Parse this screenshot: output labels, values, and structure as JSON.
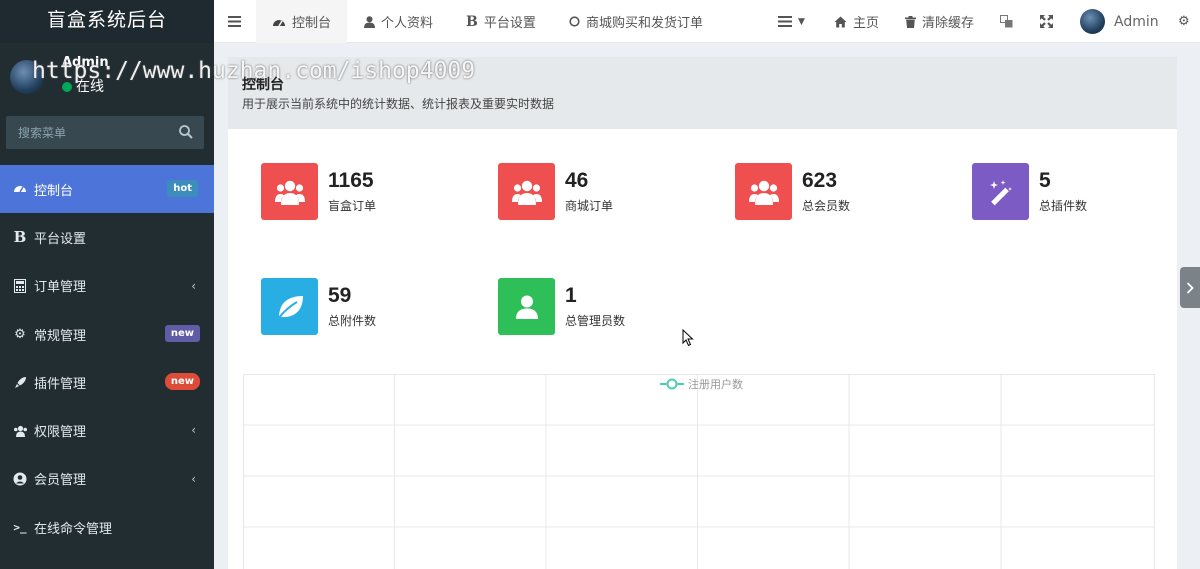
{
  "brand": "盲盒系统后台",
  "user": {
    "name": "Admin",
    "status": "在线"
  },
  "watermark": "https://www.huzhan.com/ishop4009",
  "search": {
    "placeholder": "搜索菜单"
  },
  "sidebar": {
    "items": [
      {
        "label": "控制台",
        "icon": "dashboard-icon",
        "badge": "hot",
        "active": true
      },
      {
        "label": "平台设置",
        "icon": "bold-b-icon"
      },
      {
        "label": "订单管理",
        "icon": "calculator-icon",
        "chevron": true
      },
      {
        "label": "常规管理",
        "icon": "cogs-icon",
        "badge": "new"
      },
      {
        "label": "插件管理",
        "icon": "rocket-icon",
        "badge": "new"
      },
      {
        "label": "权限管理",
        "icon": "users-icon",
        "chevron": true
      },
      {
        "label": "会员管理",
        "icon": "user-circle-icon",
        "chevron": true
      },
      {
        "label": "在线命令管理",
        "icon": "terminal-icon"
      }
    ]
  },
  "navbar": {
    "tabs": [
      {
        "label": "控制台",
        "icon": "dashboard-icon"
      },
      {
        "label": "个人资料",
        "icon": "user-icon"
      },
      {
        "label": "平台设置",
        "icon": "bold-b-icon"
      },
      {
        "label": "商城购买和发货订单",
        "icon": "circle-icon"
      }
    ],
    "home_label": "主页",
    "clear_cache_label": "清除缓存",
    "admin_label": "Admin"
  },
  "content": {
    "title": "控制台",
    "description": "用于展示当前系统中的统计数据、统计报表及重要实时数据"
  },
  "stats": [
    {
      "value": "1165",
      "label": "盲盒订单",
      "color": "#f04f4f",
      "icon": "users-icon"
    },
    {
      "value": "46",
      "label": "商城订单",
      "color": "#f04f4f",
      "icon": "users-icon"
    },
    {
      "value": "623",
      "label": "总会员数",
      "color": "#f04f4f",
      "icon": "users-icon"
    },
    {
      "value": "5",
      "label": "总插件数",
      "color": "#7c5cc4",
      "icon": "magic-wand-icon"
    },
    {
      "value": "59",
      "label": "总附件数",
      "color": "#29aee4",
      "icon": "leaf-icon"
    },
    {
      "value": "1",
      "label": "总管理员数",
      "color": "#2fbf59",
      "icon": "user-icon"
    }
  ],
  "chart": {
    "legend": "注册用户数",
    "series_color": "#4ecdb0"
  },
  "colors": {
    "sidebar_bg": "#222d32",
    "active": "#4c74d9"
  }
}
